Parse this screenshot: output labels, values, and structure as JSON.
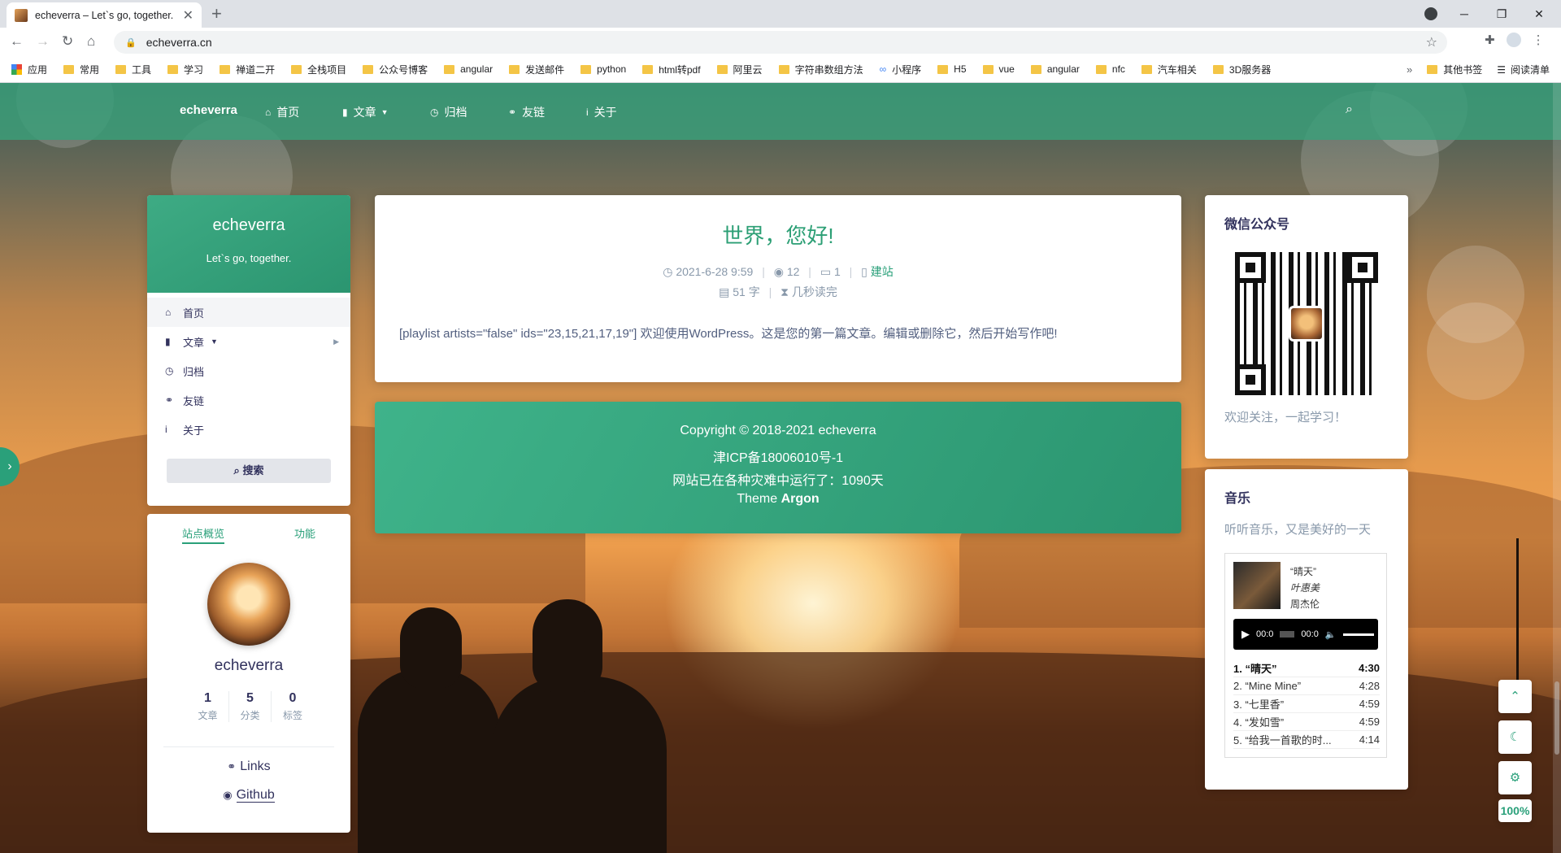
{
  "browser": {
    "tab_title": "echeverra – Let`s go, together.",
    "tab_close": "✕",
    "new_tab": "+",
    "url": "echeverra.cn",
    "bookmarks": [
      "应用",
      "常用",
      "工具",
      "学习",
      "禅道二开",
      "全栈项目",
      "公众号博客",
      "angular",
      "发送邮件",
      "python",
      "html转pdf",
      "阿里云",
      "字符串数组方法",
      "小程序",
      "H5",
      "vue",
      "angular",
      "nfc",
      "汽车相关",
      "3D服务器"
    ],
    "bookmarks_more": "»",
    "other_bookmarks": "其他书签",
    "reading_list": "阅读清单"
  },
  "nav": {
    "brand": "echeverra",
    "items": [
      {
        "icon": "home-icon",
        "glyph": "⌂",
        "label": "首页"
      },
      {
        "icon": "bookmark-icon",
        "glyph": "▮",
        "label": "文章"
      },
      {
        "icon": "clock-icon",
        "glyph": "◷",
        "label": "归档"
      },
      {
        "icon": "link-icon",
        "glyph": "⚭",
        "label": "友链"
      },
      {
        "icon": "info-icon",
        "glyph": "i",
        "label": "关于"
      }
    ]
  },
  "profile": {
    "name": "echeverra",
    "motto": "Let`s go, together.",
    "menu": [
      {
        "label": "首页",
        "glyph": "⌂"
      },
      {
        "label": "文章",
        "glyph": "▮"
      },
      {
        "label": "归档",
        "glyph": "◷"
      },
      {
        "label": "友链",
        "glyph": "⚭"
      },
      {
        "label": "关于",
        "glyph": "i"
      }
    ],
    "search_label": "搜索"
  },
  "overview": {
    "tab_overview": "站点概览",
    "tab_function": "功能",
    "name": "echeverra",
    "stats": [
      {
        "num": "1",
        "label": "文章"
      },
      {
        "num": "5",
        "label": "分类"
      },
      {
        "num": "0",
        "label": "标签"
      }
    ],
    "links_label": "Links",
    "github_label": "Github"
  },
  "post": {
    "title": "世界，您好!",
    "date": "2021-6-28 9:59",
    "views": "12",
    "comments": "1",
    "category": "建站",
    "words": "51 字",
    "read_time": "几秒读完",
    "body": "[playlist artists=\"false\" ids=\"23,15,21,17,19\"] 欢迎使用WordPress。这是您的第一篇文章。编辑或删除它，然后开始写作吧!"
  },
  "footer": {
    "copyright": "Copyright © 2018-2021 echeverra",
    "icp": "津ICP备18006010号-1",
    "uptime": "网站已在各种灾难中运行了：1090天",
    "theme_prefix": "Theme ",
    "theme_name": "Argon"
  },
  "wechat": {
    "title": "微信公众号",
    "caption": "欢迎关注，一起学习！"
  },
  "music": {
    "title": "音乐",
    "subtitle": "听听音乐，又是美好的一天",
    "now_title": "“晴天”",
    "now_album": "叶惠美",
    "now_artist": "周杰伦",
    "time_current": "00:0",
    "time_total": "00:0",
    "tracks": [
      {
        "name": "1. “晴天”",
        "dur": "4:30"
      },
      {
        "name": "2. “Mine Mine”",
        "dur": "4:28"
      },
      {
        "name": "3. “七里香”",
        "dur": "4:59"
      },
      {
        "name": "4. “发如雪”",
        "dur": "4:59"
      },
      {
        "name": "5. “给我一首歌的时...",
        "dur": "4:14"
      }
    ]
  },
  "tools": {
    "zoom": "100%"
  }
}
